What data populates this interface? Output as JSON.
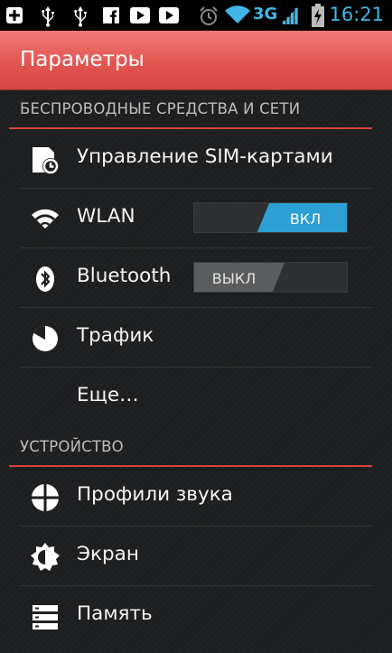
{
  "status_bar": {
    "left_icons": [
      "add-icon",
      "usb-icon",
      "usb-icon",
      "facebook-icon",
      "youtube-icon",
      "youtube-icon"
    ],
    "right_icons": [
      "alarm-icon",
      "wifi-icon",
      "signal-icon",
      "battery-charging-icon"
    ],
    "network": "3G",
    "time": "16:21"
  },
  "action_bar": {
    "title": "Параметры"
  },
  "sections": [
    {
      "header": "БЕСПРОВОДНЫЕ СРЕДСТВА И СЕТИ",
      "items": [
        {
          "label": "Управление SIM-картами",
          "icon": "sim-card-icon"
        },
        {
          "label": "WLAN",
          "icon": "wifi-icon",
          "toggle": "ВКЛ",
          "toggle_state": "on"
        },
        {
          "label": "Bluetooth",
          "icon": "bluetooth-icon",
          "toggle": "ВЫКЛ",
          "toggle_state": "off"
        },
        {
          "label": "Трафик",
          "icon": "data-usage-icon"
        },
        {
          "label": "Еще…"
        }
      ]
    },
    {
      "header": "УСТРОЙСТВО",
      "items": [
        {
          "label": "Профили звука",
          "icon": "sound-profiles-icon"
        },
        {
          "label": "Экран",
          "icon": "display-brightness-icon"
        },
        {
          "label": "Память",
          "icon": "storage-icon"
        }
      ]
    }
  ],
  "colors": {
    "accent_red": "#e1534f",
    "toggle_on": "#2c9fd4",
    "status_blue": "#41b6e6"
  }
}
